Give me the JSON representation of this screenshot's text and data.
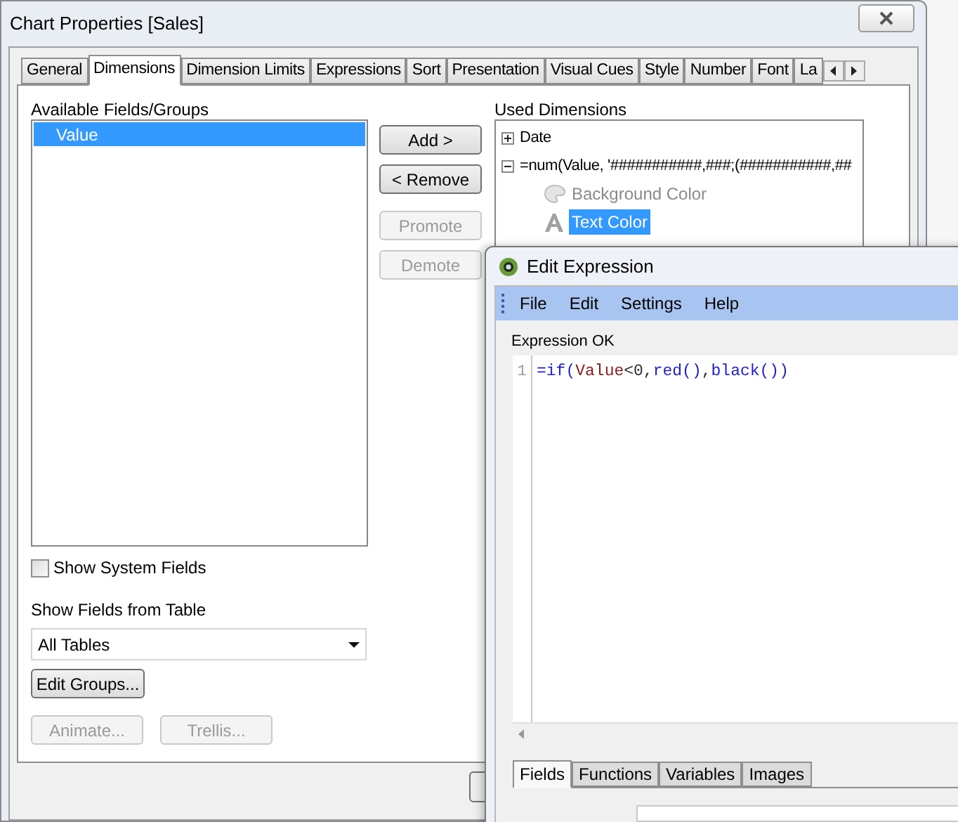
{
  "window": {
    "title": "Chart Properties [Sales]"
  },
  "tabs": [
    {
      "label": "General",
      "selected": false
    },
    {
      "label": "Dimensions",
      "selected": true
    },
    {
      "label": "Dimension Limits",
      "selected": false
    },
    {
      "label": "Expressions",
      "selected": false
    },
    {
      "label": "Sort",
      "selected": false
    },
    {
      "label": "Presentation",
      "selected": false
    },
    {
      "label": "Visual Cues",
      "selected": false
    },
    {
      "label": "Style",
      "selected": false
    },
    {
      "label": "Number",
      "selected": false
    },
    {
      "label": "Font",
      "selected": false
    },
    {
      "label": "La",
      "selected": false
    }
  ],
  "available_fields": {
    "label": "Available Fields/Groups",
    "items": [
      {
        "label": "Value",
        "selected": true
      }
    ]
  },
  "move_buttons": [
    {
      "label": "Add >",
      "disabled": false
    },
    {
      "label": "< Remove",
      "disabled": false
    },
    {
      "label": "Promote",
      "disabled": true
    },
    {
      "label": "Demote",
      "disabled": true
    }
  ],
  "used_dimensions": {
    "label": "Used Dimensions",
    "items": [
      {
        "label": "Date",
        "expanded": false
      },
      {
        "label": "=num(Value, '###########,###;(###########,##",
        "expanded": true,
        "children": [
          {
            "label": "Background Color",
            "kind": "palette",
            "selected": false,
            "disabled": true
          },
          {
            "label": "Text Color",
            "kind": "font",
            "selected": true,
            "disabled": false
          }
        ]
      }
    ]
  },
  "show_system_fields": {
    "label": "Show System Fields",
    "checked": false
  },
  "table_filter": {
    "label": "Show Fields from Table",
    "value": "All Tables"
  },
  "edit_groups": {
    "label": "Edit Groups...",
    "disabled": false
  },
  "bottom_buttons": [
    {
      "label": "Animate...",
      "disabled": true
    },
    {
      "label": "Trellis...",
      "disabled": true
    }
  ],
  "editor": {
    "title": "Edit Expression",
    "menu": [
      "File",
      "Edit",
      "Settings",
      "Help"
    ],
    "status": "Expression OK",
    "lines": [
      {
        "number": "1",
        "tokens": [
          {
            "text": "=if(",
            "kind": "function"
          },
          {
            "text": "Value",
            "kind": "field"
          },
          {
            "text": "<0,",
            "kind": "plain"
          },
          {
            "text": "red()",
            "kind": "function"
          },
          {
            "text": ",",
            "kind": "plain"
          },
          {
            "text": "black())",
            "kind": "function"
          }
        ]
      }
    ],
    "tabs": [
      {
        "label": "Fields",
        "selected": true
      },
      {
        "label": "Functions",
        "selected": false
      },
      {
        "label": "Variables",
        "selected": false
      },
      {
        "label": "Images",
        "selected": false
      }
    ]
  }
}
